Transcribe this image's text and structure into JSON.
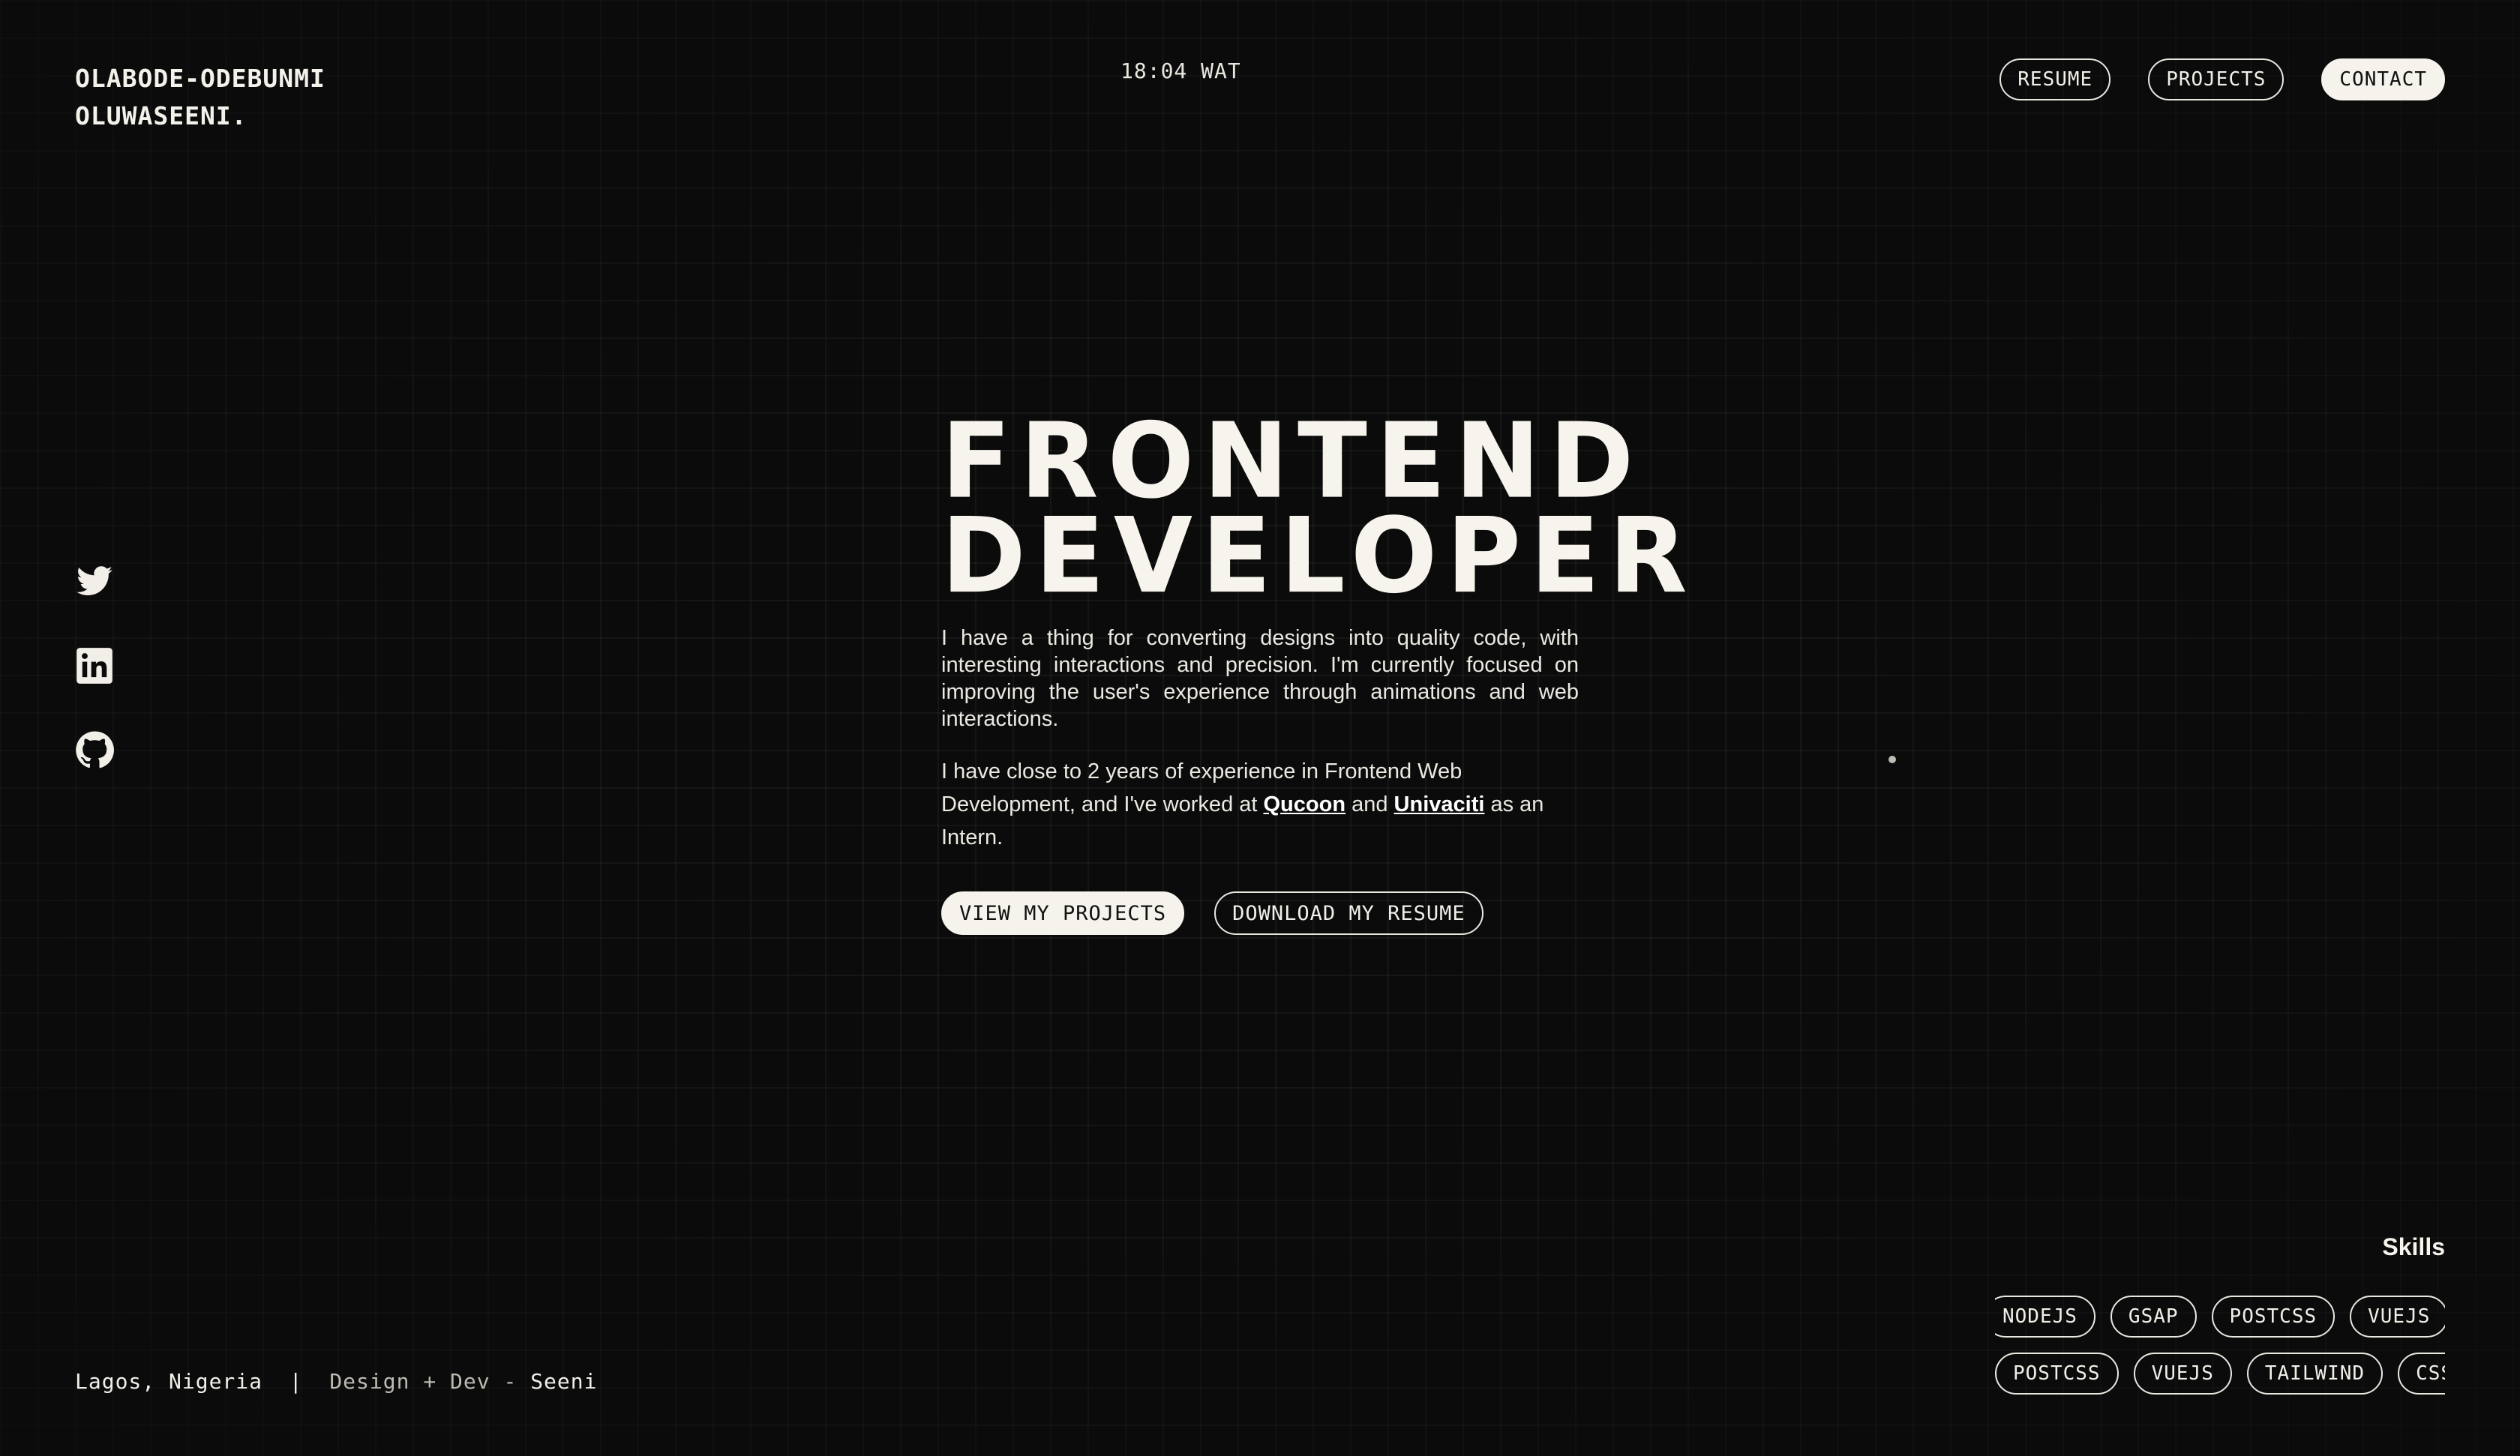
{
  "header": {
    "name_line1": "OLABODE-ODEBUNMI",
    "name_line2": "OLUWASEENI.",
    "clock": "18:04 WAT",
    "nav": [
      {
        "label": "RESUME"
      },
      {
        "label": "PROJECTS"
      },
      {
        "label": "CONTACT"
      }
    ]
  },
  "social": [
    {
      "icon": "twitter-icon"
    },
    {
      "icon": "linkedin-icon"
    },
    {
      "icon": "github-icon"
    }
  ],
  "hero": {
    "title_line1": "FRONTEND",
    "title_line2": "DEVELOPER",
    "paragraph1": "I have a thing for converting designs into quality code, with interesting interactions and precision. I'm currently focused on improving the user's experience through animations and web interactions.",
    "p2_before": "I have close to 2 years of experience in Frontend Web Development, and I've worked at ",
    "company1": "Qucoon",
    "p2_mid": " and ",
    "company2": "Univaciti",
    "p2_after": " as an Intern.",
    "cta_primary": "VIEW MY PROJECTS",
    "cta_secondary": "DOWNLOAD MY RESUME"
  },
  "footer": {
    "location": "Lagos, Nigeria",
    "separator": "|",
    "credit_prefix": "Design + Dev - ",
    "credit_name": "Seeni"
  },
  "skills": {
    "title": "Skills",
    "row1": [
      "NODEJS",
      "GSAP",
      "POSTCSS",
      "VUEJS"
    ],
    "row2": [
      "POSTCSS",
      "VUEJS",
      "TAILWIND",
      "CSS"
    ]
  },
  "colors": {
    "background": "#0b0b0b",
    "foreground": "#f1efe8"
  }
}
